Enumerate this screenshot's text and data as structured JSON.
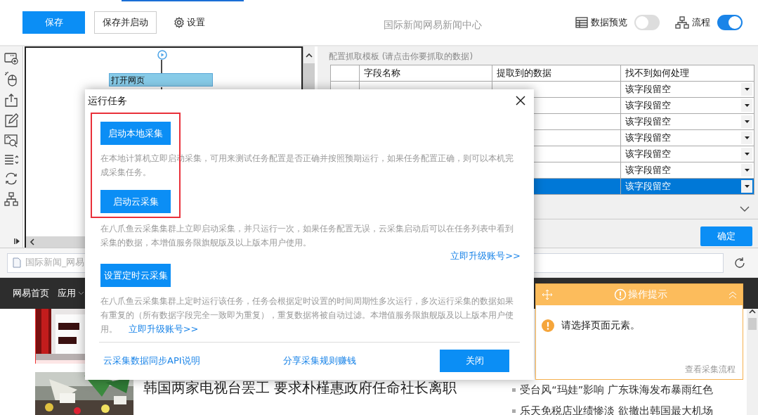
{
  "toolbar": {
    "buttons": [
      {
        "label": "保存",
        "kind": "primary"
      },
      {
        "label": "保存并启动",
        "kind": "outline"
      }
    ],
    "settings": "设置",
    "title": "国际新闻网易新闻中心",
    "toggles": [
      {
        "label": "数据预览",
        "on": false
      },
      {
        "label": "流程",
        "on": true
      }
    ]
  },
  "flow": {
    "node": "打开网页"
  },
  "template": {
    "title": "配置抓取模板 (请点击你要抓取的数据)",
    "columns": [
      "字段名称",
      "提取到的数据",
      "找不到如何处理"
    ],
    "rows": [
      {
        "action": "该字段留空",
        "selected": false
      },
      {
        "action": "该字段留空",
        "selected": false
      },
      {
        "action": "该字段留空",
        "selected": false
      },
      {
        "action": "该字段留空",
        "selected": false
      },
      {
        "action": "该字段留空",
        "selected": false
      },
      {
        "action": "该字段留空",
        "selected": false
      },
      {
        "action": "该字段留空",
        "selected": true
      }
    ],
    "confirm": "确定"
  },
  "browser": {
    "address": "国际新闻_网易",
    "nav": [
      {
        "label": "网易首页",
        "dropdown": false
      },
      {
        "label": "应用",
        "dropdown": true
      }
    ],
    "headline": "韩国两家电视台罢工 要求朴槿惠政府任命社长离职",
    "news": [
      "受台风“玛娃”影响 广东珠海发布暴雨红色",
      "乐天免税店业绩惨淡 欲撤出韩国最大机场"
    ]
  },
  "tips": {
    "title": "操作提示",
    "message": "请选择页面元素。",
    "link": "查看采集流程"
  },
  "dialog": {
    "title": "运行任务",
    "options": [
      {
        "button": "启动本地采集",
        "description": "在本地计算机立即启动采集，可用来测试任务配置是否正确并按照预期运行，如果任务配置正确，则可以本机完成采集任务。"
      },
      {
        "button": "启动云采集",
        "description": "在八爪鱼云采集集群上立即启动采集，并只运行一次，如果任务配置无误，云采集启动后可以在任务列表中看到采集的数据，本增值服务限旗舰版及以上版本用户使用。",
        "link": "立即升级账号>>"
      },
      {
        "button": "设置定时云采集",
        "description": "在八爪鱼云采集集群上定时运行该任务，任务会根据定时设置的时间周期性多次运行，多次运行采集的数据如果有重复的（所有数据字段完全一致即为重复），重复数据将被自动过滤。本增值服务限旗舰版及以上版本用户使用。",
        "link": "立即升级账号>>"
      }
    ],
    "footer_links": [
      "云采集数据同步API说明",
      "分享采集规则赚钱"
    ],
    "close": "关闭"
  }
}
